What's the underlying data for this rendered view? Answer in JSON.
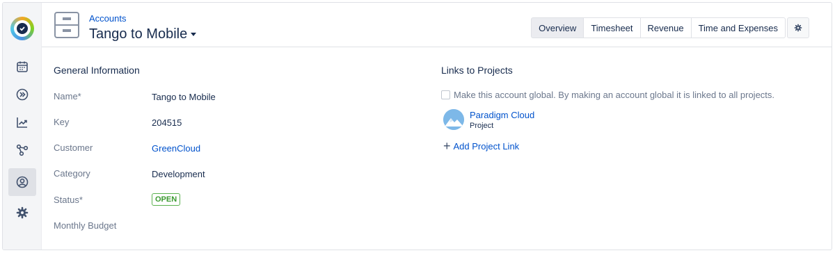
{
  "app": {
    "logo_icon": "tempo-check-logo"
  },
  "sidebar": {
    "items": [
      {
        "icon": "calendar-icon",
        "active": false
      },
      {
        "icon": "chevrons-right-circle-icon",
        "active": false
      },
      {
        "icon": "trending-up-icon",
        "active": false
      },
      {
        "icon": "network-icon",
        "active": false
      },
      {
        "icon": "user-circle-icon",
        "active": true
      },
      {
        "icon": "gear-icon",
        "active": false
      }
    ]
  },
  "header": {
    "breadcrumb": "Accounts",
    "title": "Tango to Mobile",
    "tabs": [
      {
        "label": "Overview",
        "active": true
      },
      {
        "label": "Timesheet",
        "active": false
      },
      {
        "label": "Revenue",
        "active": false
      },
      {
        "label": "Time and Expenses",
        "active": false
      }
    ],
    "settings_icon": "gear-icon"
  },
  "general": {
    "title": "General Information",
    "fields": {
      "name": {
        "label": "Name*",
        "value": "Tango to Mobile"
      },
      "key": {
        "label": "Key",
        "value": "204515"
      },
      "customer": {
        "label": "Customer",
        "value": "GreenCloud"
      },
      "category": {
        "label": "Category",
        "value": "Development"
      },
      "status": {
        "label": "Status*",
        "value": "OPEN"
      },
      "monthly_budget": {
        "label": "Monthly Budget",
        "value": ""
      }
    }
  },
  "links": {
    "title": "Links to Projects",
    "global_text": "Make this account global. By making an account global it is linked to all projects.",
    "global_checked": false,
    "project": {
      "name": "Paradigm Cloud",
      "type": "Project"
    },
    "add_label": "Add Project Link"
  },
  "colors": {
    "link": "#0052cc",
    "status_green": "#3a9a2f",
    "sidebar_bg": "#f4f5f7"
  }
}
